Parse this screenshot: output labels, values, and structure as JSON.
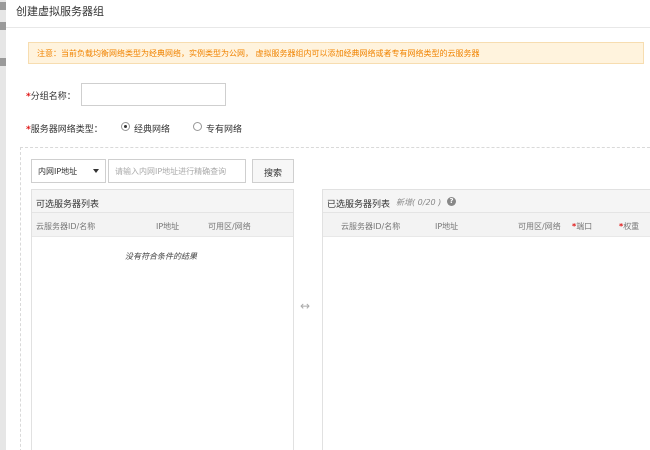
{
  "dialog": {
    "title": "创建虚拟服务器组"
  },
  "notice": {
    "text": "注意：当前负载均衡网络类型为经典网络，实例类型为公网， 虚拟服务器组内可以添加经典网络或者专有网络类型的云服务器"
  },
  "form": {
    "required_mark": "*",
    "group_name_label": "分组名称：",
    "group_name_value": "",
    "network_type_label": "服务器网络类型：",
    "network_options": [
      {
        "label": "经典网络",
        "selected": true
      },
      {
        "label": "专有网络",
        "selected": false
      }
    ]
  },
  "search": {
    "filter_selected": "内网IP地址",
    "placeholder": "请输入内网IP地址进行精确查询",
    "button_label": "搜索"
  },
  "available_list": {
    "title": "可选服务器列表",
    "columns": [
      "云服务器ID/名称",
      "IP地址",
      "可用区/网络"
    ],
    "empty_text": "没有符合条件的结果"
  },
  "selected_list": {
    "title": "已选服务器列表",
    "count_text": "新增( 0/20 )",
    "columns": [
      "云服务器ID/名称",
      "IP地址",
      "可用区/网络",
      "端口",
      "权重"
    ]
  },
  "icons": {
    "help": "help-icon",
    "swap": "transfer-arrows-icon",
    "caret": "caret-down-icon"
  },
  "colors": {
    "notice_text": "#f08300",
    "notice_bg": "#fff3dd",
    "required": "#e01515"
  }
}
